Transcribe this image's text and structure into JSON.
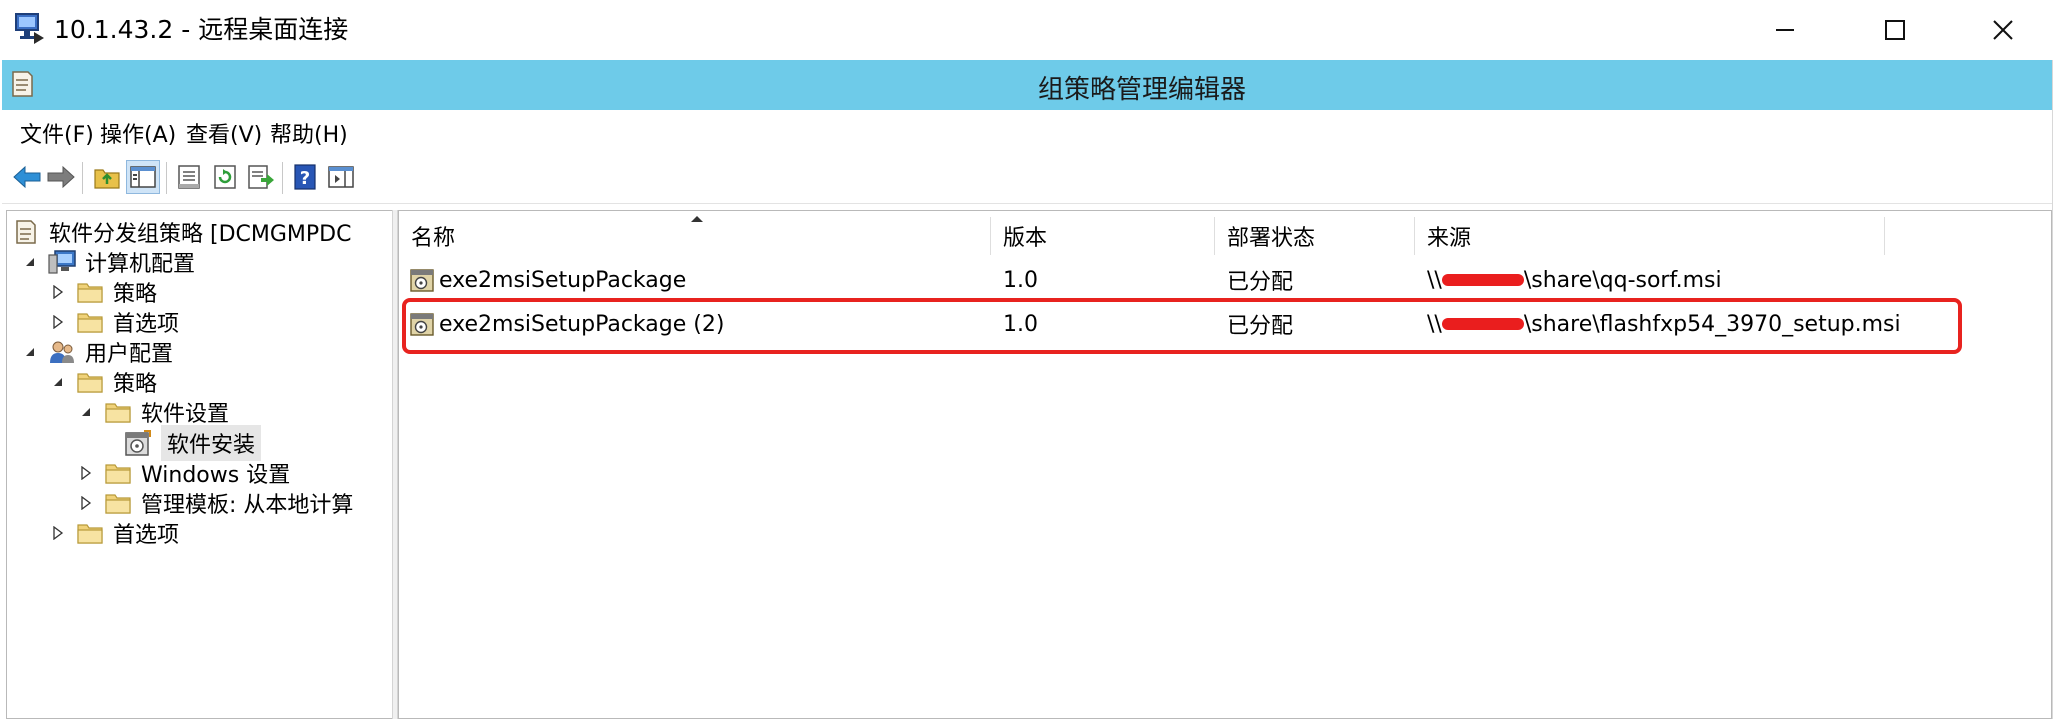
{
  "rdp": {
    "title": "10.1.43.2 - 远程桌面连接",
    "icon": "remote-desktop-icon",
    "buttons": [
      "minimize",
      "maximize",
      "close"
    ]
  },
  "app": {
    "title": "组策略管理编辑器",
    "icon": "policy-document-icon",
    "accent_color": "#6ecbe9"
  },
  "menu": {
    "file": "文件(F)",
    "action": "操作(A)",
    "view": "查看(V)",
    "help": "帮助(H)"
  },
  "toolbar": {
    "icons": [
      "back-icon",
      "forward-icon",
      "up-folder-icon",
      "show-hide-tree-icon",
      "properties-icon",
      "refresh-icon",
      "export-list-icon",
      "help-icon",
      "show-action-pane-icon"
    ]
  },
  "tree": {
    "root": "软件分发组策略 [DCMGMPDC",
    "computer_config": "计算机配置",
    "computer_policies": "策略",
    "computer_preferences": "首选项",
    "user_config": "用户配置",
    "user_policies": "策略",
    "software_settings": "软件设置",
    "software_install": "软件安装",
    "windows_settings": "Windows 设置",
    "admin_templates": "管理模板: 从本地计算",
    "user_preferences": "首选项"
  },
  "list": {
    "columns": [
      "名称",
      "版本",
      "部署状态",
      "来源"
    ],
    "sort_column": "名称",
    "rows": [
      {
        "name": "exe2msiSetupPackage",
        "version": "1.0",
        "status": "已分配",
        "source_prefix": "\\\\",
        "source_suffix": "\\share\\qq-sorf.msi"
      },
      {
        "name": "exe2msiSetupPackage (2)",
        "version": "1.0",
        "status": "已分配",
        "source_prefix": "\\\\",
        "source_suffix": "\\share\\flashfxp54_3970_setup.msi",
        "highlighted": true
      }
    ],
    "highlight_color": "#e8231f"
  }
}
